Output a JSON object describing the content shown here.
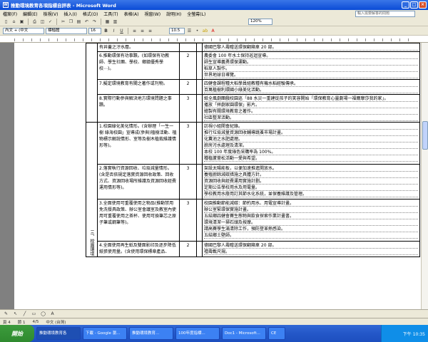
{
  "window": {
    "title": "推動環境教育各項指標自評表 - Microsoft Word"
  },
  "menu": [
    "檔案(F)",
    "編輯(E)",
    "檢視(V)",
    "插入(I)",
    "格式(O)",
    "工具(T)",
    "表格(A)",
    "視窗(W)",
    "說明(H)",
    "全螢幕(L)"
  ],
  "help_placeholder": "輸入需要解答的問題",
  "toolbar": {
    "zoom": "120%",
    "style": "內文 + (中文",
    "style2": "標楷體",
    "size": "16",
    "size2": "10.5"
  },
  "table": {
    "rows": [
      {
        "item": "有井蓋之汙水層。",
        "score": "",
        "desc": [
          "德國巴黎人壽贈送環保翻箱車 20 部。"
        ]
      },
      {
        "item": "6.推動環保有功事蹟。(如環保有功教師、學生社團、學校、鄉鎮優秀學校⋯)。",
        "score": "2",
        "desc": [
          "農委會 100 年水土保持巡迴宣導。",
          "師生宣導義勇環保運動。",
          "稻草人製作。",
          "世界地球日導覽。"
        ]
      },
      {
        "item": "7.擬定環境教育有關之著作或刊物。",
        "score": "2",
        "desc": [
          "四健會課程種大稻學員組教種有機水稻經驗傳承。",
          "百萬植樹利環國小綠美化活動。"
        ]
      },
      {
        "item": "8.實際行動參與解決地方環境問題之事蹟。",
        "score": "3",
        "desc": [
          "紙全風劇團戲校園巡「88 水災一重建從孩子的笑容開始「環保教育心靈劇場一福爾摩莎我的家」。",
          "播放「拝劇家園環保」影片。",
          "繪製有關環境教育之著作。",
          "社區整潔活動。"
        ]
      },
      {
        "item": "1.校園綠化美化情形。(含辦理「一生一樹 綠海校園」宣導成(參與)植樹活動、植物標示解說情形、室等及樹木植栽維護情形等)。",
        "score": "3",
        "desc": [
          "訪視小組開會紀錄。",
          "推行垃圾減量資源回收輔導跳蚤市場計畫。",
          "化糞池之水肥處理。",
          "廚房污水處理及清潔。",
          "本校 100 年度綠色采購率為 100%。",
          "種植蘆薈松活動一愛與希望。"
        ]
      },
      {
        "item": "2.落實執行資源回收、垃圾減量情形。(含是否依規定落實資源回收政策、回收方式、資源回收場所維護及資源回收經費運用情形等)。",
        "score": "3",
        "desc": [
          "架設太陽能板，以便加速推進開放水。",
          "養殖廚餘減碳措施之具體方針。",
          "資源回收與經費運用實施計劃。",
          "定期公告學校用水及用電量。",
          "學校教用水廢用訂其節水化系統，並保養維護及管理。"
        ]
      },
      {
        "item": "3.全面使用可重覆使用之物品(推動禁用免洗餐具政策、辦公室會議室及教室內使用可重覆使用之茶杯、使用可換筆芯之原子筆或鋼筆等)。",
        "score": "3",
        "desc": [
          "校園推動節能減碳：節約用水、用電宣導計畫。",
          "辦公室緊環保實施計畫。",
          "五結鄉四健會賽生態物與飲食探索作業計畫書。",
          "環境清潔一掃石頭及按摩。",
          "請高賽學生滿清除工作，預防登革熱感染。",
          "五結鄉土壁師。"
        ]
      },
      {
        "item": "4.全面使用再生紙及雙面影印及逐步降低紙張使用量。(含使用環保標章產品、",
        "score": "2",
        "desc": [
          "德國巴黎人壽贈送環保翻箱車 20 部。",
          "禮壽載尺規。"
        ]
      }
    ],
    "category": "三、校園環境"
  },
  "taskbar": {
    "start": "開始",
    "items": [
      "推動環境教育各",
      "下載 - Google 瀏...",
      "推動環境教育...",
      "100年度指標...",
      "Doc1 - Microsoft...",
      "CE"
    ],
    "clock": "下午 10:35"
  },
  "status": {
    "page": "頁 4",
    "section": "節 1",
    "pos": "4/5",
    "lang": "中文 (台灣)"
  }
}
